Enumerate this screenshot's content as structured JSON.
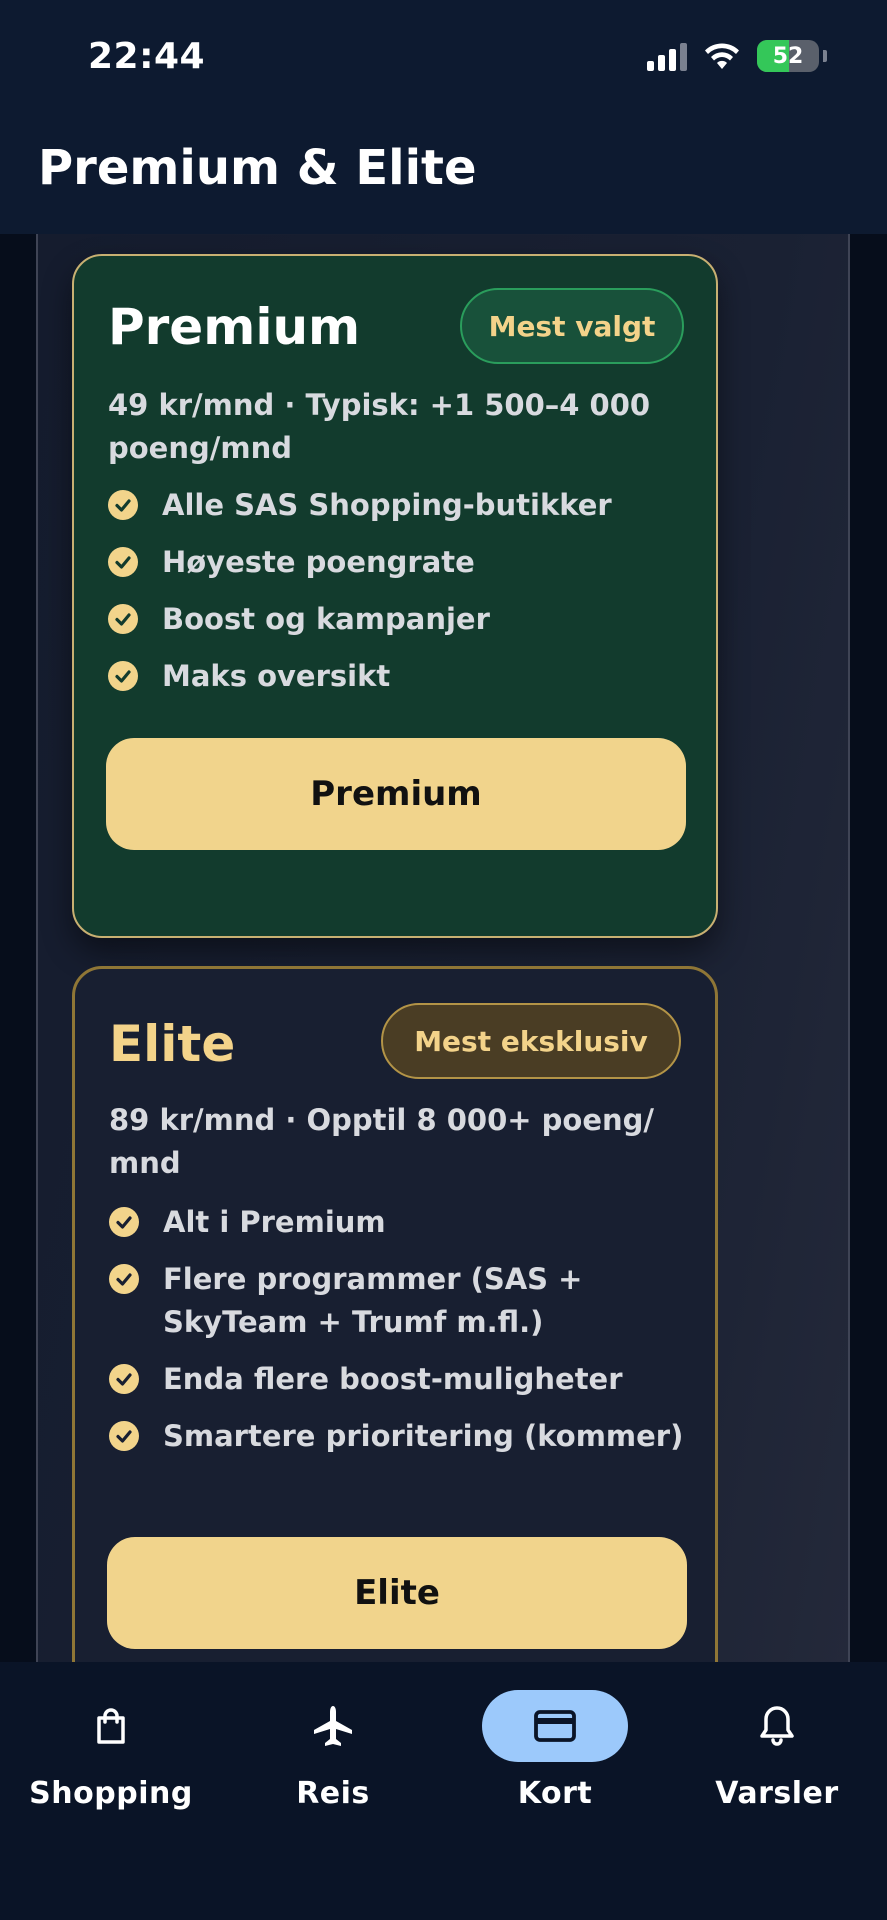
{
  "status_bar": {
    "time": "22:44",
    "battery": "52",
    "battery_level": 0.52
  },
  "header": {
    "title": "Premium & Elite"
  },
  "plans": [
    {
      "name": "Premium",
      "badge": "Mest valgt",
      "price_line": "49 kr/mnd · Typisk: +1 500–4 000 poeng/mnd",
      "features": [
        "Alle SAS Shopping-butikker",
        "Høyeste poengrate",
        "Boost og kampanjer",
        "Maks oversikt"
      ],
      "button_label": "Premium"
    },
    {
      "name": "Elite",
      "badge": "Mest eksklusiv",
      "price_line": "89 kr/mnd · Opptil 8 000+ poeng/ mnd",
      "features": [
        "Alt i Premium",
        "Flere programmer (SAS + SkyTeam + Trumf m.fl.)",
        "Enda flere boost-muligheter",
        "Smartere prioritering (kommer)"
      ],
      "button_label": "Elite"
    }
  ],
  "tabs": [
    {
      "label": "Shopping",
      "icon": "shopping-bag-icon"
    },
    {
      "label": "Reis",
      "icon": "airplane-icon"
    },
    {
      "label": "Kort",
      "icon": "card-icon",
      "active": true
    },
    {
      "label": "Varsler",
      "icon": "bell-icon"
    }
  ],
  "colors": {
    "accent": "#f1d48c",
    "premium_card": "#123b2d",
    "elite_card": "#181f31",
    "active_tab": "#9cc9fb"
  }
}
